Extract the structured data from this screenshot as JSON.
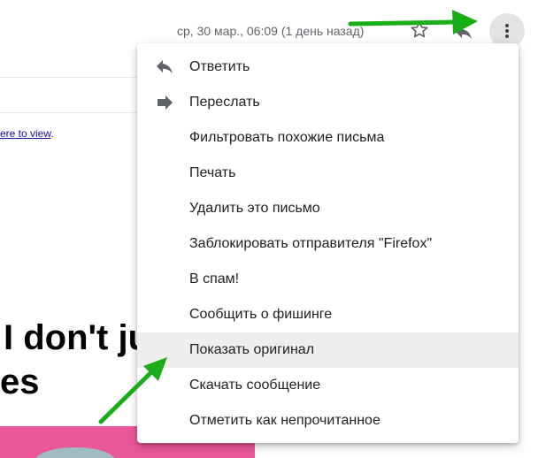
{
  "email": {
    "view_link_text": "ere to view",
    "view_link_suffix": ".",
    "headline_line1": "I don't ju",
    "headline_line2": "es"
  },
  "header": {
    "date": "ср, 30 мар., 06:09 (1 день назад)",
    "star_icon": "star-outline-icon",
    "reply_icon": "reply-icon",
    "more_icon": "more-vert-icon"
  },
  "menu": {
    "items": [
      {
        "label": "Ответить",
        "icon": "reply-icon"
      },
      {
        "label": "Переслать",
        "icon": "forward-icon"
      },
      {
        "label": "Фильтровать похожие письма",
        "icon": ""
      },
      {
        "label": "Печать",
        "icon": ""
      },
      {
        "label": "Удалить это письмо",
        "icon": ""
      },
      {
        "label": "Заблокировать отправителя \"Firefox\"",
        "icon": ""
      },
      {
        "label": "В спам!",
        "icon": ""
      },
      {
        "label": "Сообщить о фишинге",
        "icon": ""
      },
      {
        "label": "Показать оригинал",
        "icon": "",
        "highlighted": true
      },
      {
        "label": "Скачать сообщение",
        "icon": ""
      },
      {
        "label": "Отметить как непрочитанное",
        "icon": ""
      }
    ]
  },
  "colors": {
    "annotation_arrow": "#1aad19",
    "menu_highlight": "#eeeeee",
    "banner_pink": "#e9579a"
  }
}
